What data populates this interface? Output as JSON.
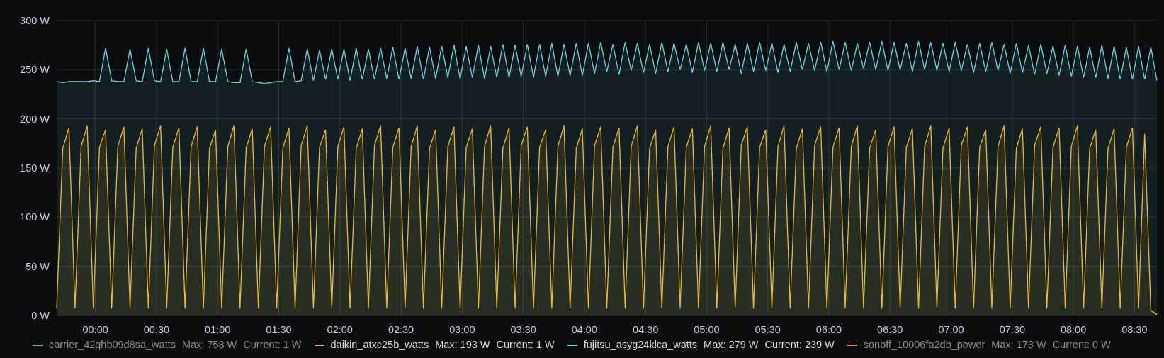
{
  "chart_data": {
    "type": "area",
    "x": [
      -19,
      -16,
      -13,
      -10,
      -7,
      -4,
      -1,
      2,
      5,
      8,
      11,
      14,
      17,
      20,
      23,
      26,
      29,
      32,
      35,
      38,
      41,
      44,
      47,
      50,
      53,
      56,
      59,
      62,
      65,
      68,
      71,
      74,
      77,
      80,
      83,
      86,
      89,
      92,
      95,
      98,
      101,
      104,
      107,
      110,
      113,
      116,
      119,
      122,
      125,
      128,
      131,
      134,
      137,
      140,
      143,
      146,
      149,
      152,
      155,
      158,
      161,
      164,
      167,
      170,
      173,
      176,
      179,
      182,
      185,
      188,
      191,
      194,
      197,
      200,
      203,
      206,
      209,
      212,
      215,
      218,
      221,
      224,
      227,
      230,
      233,
      236,
      239,
      242,
      245,
      248,
      251,
      254,
      257,
      260,
      263,
      266,
      269,
      272,
      275,
      278,
      281,
      284,
      287,
      290,
      293,
      296,
      299,
      302,
      305,
      308,
      311,
      314,
      317,
      320,
      323,
      326,
      329,
      332,
      335,
      338,
      341,
      344,
      347,
      350,
      353,
      356,
      359,
      362,
      365,
      368,
      371,
      374,
      377,
      380,
      383,
      386,
      389,
      392,
      395,
      398,
      401,
      404,
      407,
      410,
      413,
      416,
      419,
      422,
      425,
      428,
      431,
      434,
      437,
      440,
      443,
      446,
      449,
      452,
      455,
      458,
      461,
      464,
      467,
      470,
      473,
      476,
      479,
      482,
      485,
      488,
      491,
      494,
      497,
      500,
      503,
      506,
      509,
      512,
      515,
      518,
      521
    ],
    "series": [
      {
        "name": "daikin_atxc25b_watts",
        "color": "#eab839",
        "values": [
          7,
          170,
          191,
          7,
          172,
          193,
          7,
          171,
          189,
          7,
          172,
          192,
          7,
          170,
          190,
          7,
          173,
          193,
          7,
          171,
          191,
          7,
          172,
          192,
          7,
          170,
          189,
          7,
          172,
          193,
          7,
          171,
          190,
          7,
          172,
          192,
          7,
          170,
          191,
          7,
          173,
          193,
          7,
          171,
          189,
          7,
          172,
          192,
          7,
          170,
          190,
          7,
          173,
          193,
          7,
          171,
          191,
          7,
          172,
          193,
          7,
          170,
          189,
          7,
          172,
          192,
          7,
          171,
          190,
          7,
          172,
          193,
          7,
          170,
          191,
          7,
          173,
          192,
          7,
          171,
          189,
          7,
          172,
          193,
          7,
          170,
          190,
          7,
          173,
          192,
          7,
          171,
          191,
          7,
          172,
          193,
          7,
          170,
          189,
          7,
          172,
          192,
          7,
          171,
          190,
          7,
          172,
          193,
          7,
          170,
          191,
          7,
          173,
          192,
          7,
          171,
          189,
          7,
          172,
          193,
          7,
          170,
          190,
          7,
          173,
          192,
          7,
          171,
          191,
          7,
          172,
          193,
          7,
          170,
          189,
          7,
          172,
          192,
          7,
          171,
          190,
          7,
          172,
          193,
          7,
          170,
          191,
          7,
          173,
          192,
          7,
          171,
          189,
          7,
          172,
          193,
          7,
          170,
          190,
          7,
          173,
          192,
          7,
          171,
          191,
          7,
          172,
          193,
          7,
          170,
          189,
          7,
          170,
          190,
          7,
          171,
          191,
          7,
          185,
          5,
          1
        ]
      },
      {
        "name": "fujitsu_asyg24klca_watts",
        "color": "#6ed0e0",
        "values": [
          238,
          237,
          238,
          238,
          238,
          238,
          239,
          238,
          272,
          239,
          238,
          238,
          271,
          239,
          238,
          272,
          239,
          238,
          271,
          238,
          238,
          272,
          238,
          238,
          272,
          238,
          238,
          271,
          238,
          237,
          237,
          271,
          238,
          237,
          236,
          237,
          238,
          238,
          272,
          238,
          239,
          271,
          239,
          270,
          240,
          271,
          240,
          271,
          239,
          272,
          240,
          271,
          240,
          272,
          241,
          273,
          240,
          272,
          241,
          274,
          240,
          273,
          241,
          274,
          242,
          275,
          241,
          274,
          242,
          275,
          241,
          274,
          242,
          276,
          242,
          275,
          243,
          276,
          242,
          276,
          243,
          277,
          243,
          276,
          244,
          277,
          244,
          277,
          246,
          278,
          248,
          276,
          245,
          278,
          249,
          277,
          247,
          276,
          246,
          278,
          248,
          277,
          250,
          276,
          247,
          278,
          249,
          277,
          248,
          278,
          250,
          276,
          246,
          277,
          248,
          278,
          249,
          277,
          247,
          276,
          248,
          278,
          250,
          277,
          249,
          278,
          248,
          279,
          250,
          278,
          249,
          277,
          251,
          278,
          250,
          279,
          249,
          278,
          250,
          277,
          248,
          279,
          250,
          278,
          249,
          277,
          248,
          278,
          249,
          276,
          247,
          277,
          248,
          278,
          249,
          276,
          246,
          277,
          247,
          275,
          245,
          276,
          246,
          274,
          244,
          275,
          243,
          274,
          242,
          273,
          242,
          275,
          241,
          274,
          240,
          273,
          240,
          274,
          240,
          273,
          239
        ]
      }
    ],
    "grid": true,
    "xlim": [
      -19,
      521
    ],
    "ylim": [
      0,
      300
    ],
    "xticks": [
      {
        "value": 0,
        "label": "00:00"
      },
      {
        "value": 30,
        "label": "00:30"
      },
      {
        "value": 60,
        "label": "01:00"
      },
      {
        "value": 90,
        "label": "01:30"
      },
      {
        "value": 120,
        "label": "02:00"
      },
      {
        "value": 150,
        "label": "02:30"
      },
      {
        "value": 180,
        "label": "03:00"
      },
      {
        "value": 210,
        "label": "03:30"
      },
      {
        "value": 240,
        "label": "04:00"
      },
      {
        "value": 270,
        "label": "04:30"
      },
      {
        "value": 300,
        "label": "05:00"
      },
      {
        "value": 330,
        "label": "05:30"
      },
      {
        "value": 360,
        "label": "06:00"
      },
      {
        "value": 390,
        "label": "06:30"
      },
      {
        "value": 420,
        "label": "07:00"
      },
      {
        "value": 450,
        "label": "07:30"
      },
      {
        "value": 480,
        "label": "08:00"
      },
      {
        "value": 510,
        "label": "08:30"
      }
    ],
    "yticks": [
      {
        "value": 0,
        "label": "0 W"
      },
      {
        "value": 50,
        "label": "50 W"
      },
      {
        "value": 100,
        "label": "100 W"
      },
      {
        "value": 150,
        "label": "150 W"
      },
      {
        "value": 200,
        "label": "200 W"
      },
      {
        "value": 250,
        "label": "250 W"
      },
      {
        "value": 300,
        "label": "300 W"
      }
    ]
  },
  "legend": [
    {
      "name": "carrier_42qhb09d8sa_watts",
      "max": "Max: 758 W",
      "current": "Current: 1 W",
      "color": "#73bf69",
      "hidden": true
    },
    {
      "max": "Max: 193 W",
      "current": "Current: 1 W",
      "hidden": false
    },
    {
      "max": "Max: 279 W",
      "current": "Current: 239 W",
      "hidden": false
    },
    {
      "name": "sonoff_10006fa2db_power",
      "max": "Max: 173 W",
      "current": "Current: 0 W",
      "color": "#ef843c",
      "hidden": true
    }
  ]
}
